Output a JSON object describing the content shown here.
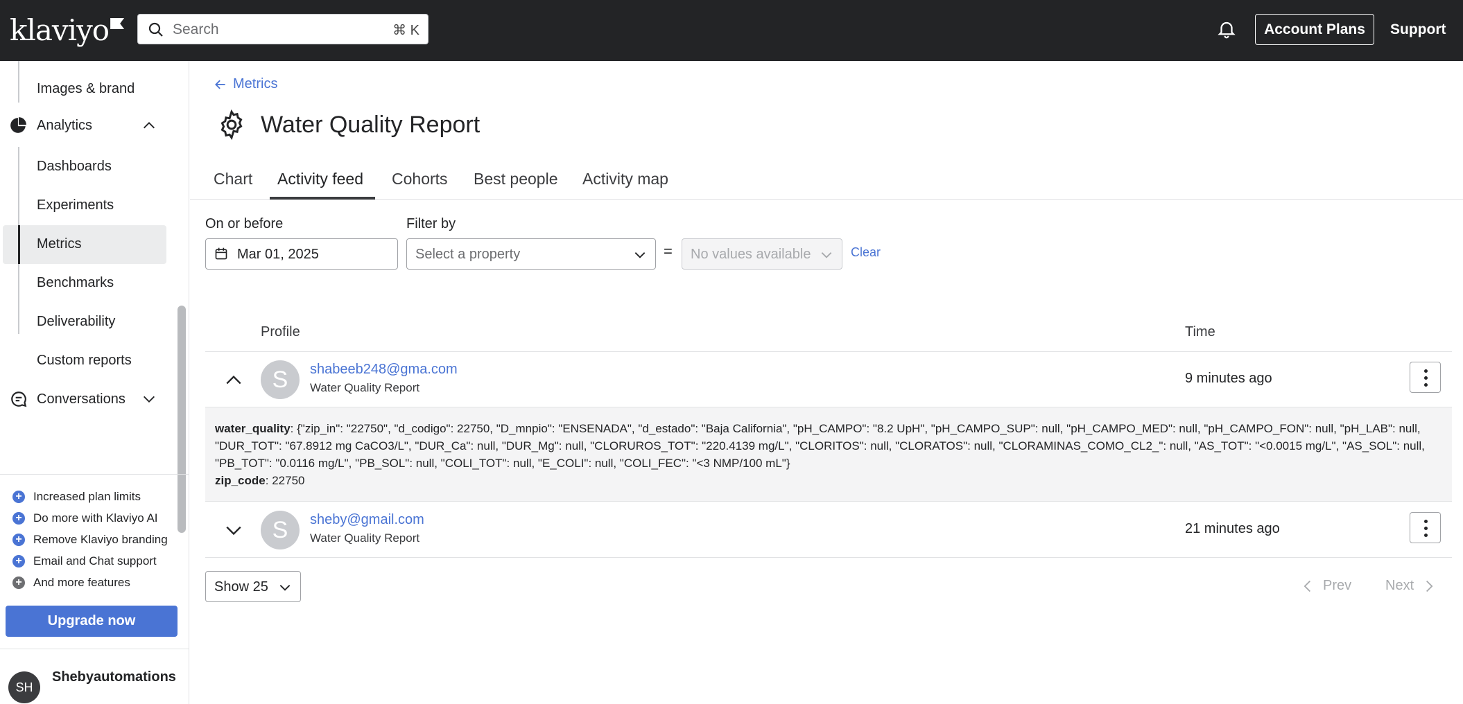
{
  "topbar": {
    "logo": "klaviyo",
    "search_placeholder": "Search",
    "search_shortcut": "⌘ K",
    "account_plans": "Account Plans",
    "support": "Support"
  },
  "sidebar": {
    "items": {
      "images_brand": "Images & brand",
      "analytics": "Analytics",
      "dashboards": "Dashboards",
      "experiments": "Experiments",
      "metrics": "Metrics",
      "benchmarks": "Benchmarks",
      "deliverability": "Deliverability",
      "custom_reports": "Custom reports",
      "conversations": "Conversations"
    },
    "promos": [
      "Increased plan limits",
      "Do more with Klaviyo AI",
      "Remove Klaviyo branding",
      "Email and Chat support",
      "And more features"
    ],
    "upgrade": "Upgrade now",
    "user_initials": "SH",
    "user_name": "Shebyautomations"
  },
  "main": {
    "back": "Metrics",
    "title": "Water Quality Report",
    "tabs": [
      "Chart",
      "Activity feed",
      "Cohorts",
      "Best people",
      "Activity map"
    ],
    "active_tab": "Activity feed",
    "filters": {
      "date_label": "On or before",
      "date_value": "Mar 01, 2025",
      "filter_label": "Filter by",
      "property_placeholder": "Select a property",
      "equals": "=",
      "values_placeholder": "No values available",
      "clear": "Clear"
    },
    "table": {
      "col_profile": "Profile",
      "col_time": "Time",
      "rows": [
        {
          "initial": "S",
          "email": "shabeeb248@gma.com",
          "metric": "Water Quality Report",
          "time": "9 minutes ago",
          "expanded": true,
          "details": {
            "key1": "water_quality",
            "value1": "{\"zip_in\": \"22750\", \"d_codigo\": 22750, \"D_mnpio\": \"ENSENADA\", \"d_estado\": \"Baja California\", \"pH_CAMPO\": \"8.2 UpH\", \"pH_CAMPO_SUP\": null, \"pH_CAMPO_MED\": null, \"pH_CAMPO_FON\": null, \"pH_LAB\": null, \"DUR_TOT\": \"67.8912 mg CaCO3/L\", \"DUR_Ca\": null, \"DUR_Mg\": null, \"CLORUROS_TOT\": \"220.4139 mg/L\", \"CLORITOS\": null, \"CLORATOS\": null, \"CLORAMINAS_COMO_CL2_\": null, \"AS_TOT\": \"<0.0015 mg/L\", \"AS_SOL\": null, \"PB_TOT\": \"0.0116 mg/L\", \"PB_SOL\": null, \"COLI_TOT\": null, \"E_COLI\": null, \"COLI_FEC\": \"<3 NMP/100 mL\"}",
            "key2": "zip_code",
            "value2": "22750"
          }
        },
        {
          "initial": "S",
          "email": "sheby@gmail.com",
          "metric": "Water Quality Report",
          "time": "21 minutes ago",
          "expanded": false
        }
      ]
    },
    "pagination": {
      "page_size": "Show 25",
      "prev": "Prev",
      "next": "Next"
    }
  },
  "colors": {
    "topbar_bg": "#232426",
    "link": "#4a74d4",
    "upgrade_bg": "#4a74d4"
  }
}
